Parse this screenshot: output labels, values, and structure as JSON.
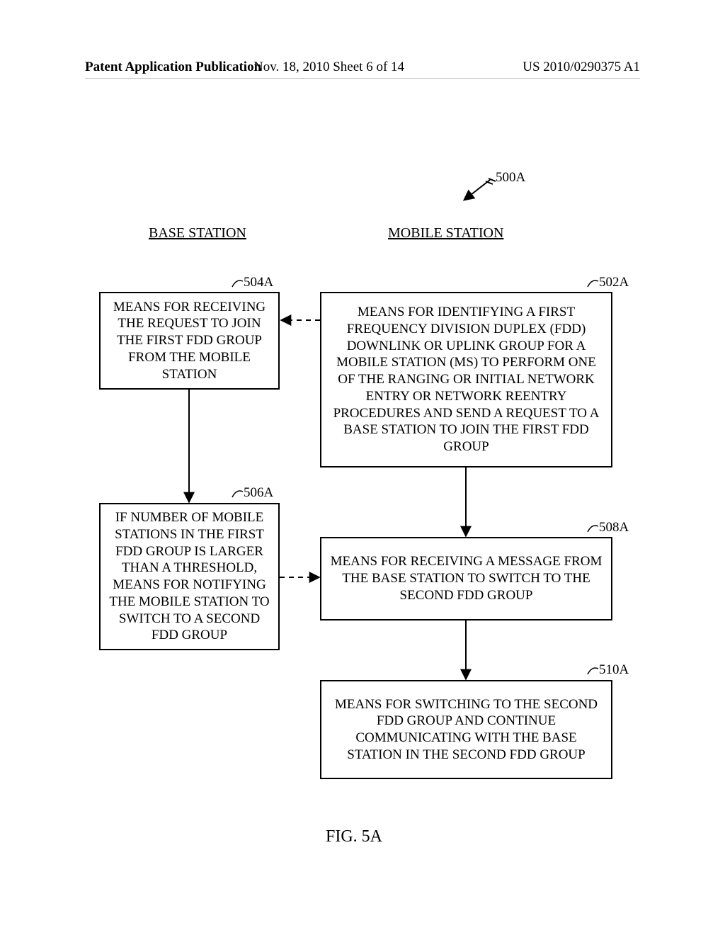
{
  "header": {
    "left": "Patent Application Publication",
    "center": "Nov. 18, 2010  Sheet 6 of 14",
    "right": "US 2010/0290375 A1"
  },
  "diagram": {
    "title_ref": "500A",
    "columns": {
      "left": "BASE STATION",
      "right": "MOBILE STATION"
    },
    "boxes": {
      "b504a": {
        "ref": "504A",
        "text": "MEANS FOR RECEIVING THE REQUEST TO JOIN THE FIRST FDD GROUP FROM THE MOBILE STATION"
      },
      "b502a": {
        "ref": "502A",
        "text": "MEANS FOR IDENTIFYING A FIRST FREQUENCY DIVISION DUPLEX (FDD) DOWNLINK OR UPLINK GROUP FOR A MOBILE STATION (MS) TO PERFORM ONE OF THE RANGING OR INITIAL NETWORK ENTRY OR NETWORK REENTRY PROCEDURES AND SEND A REQUEST TO A BASE STATION TO JOIN THE FIRST FDD GROUP"
      },
      "b506a": {
        "ref": "506A",
        "text": "IF NUMBER OF MOBILE STATIONS IN THE FIRST FDD GROUP IS LARGER THAN A THRESHOLD, MEANS FOR NOTIFYING THE MOBILE STATION TO SWITCH TO A SECOND FDD GROUP"
      },
      "b508a": {
        "ref": "508A",
        "text": "MEANS FOR RECEIVING A MESSAGE FROM THE BASE STATION TO SWITCH TO THE SECOND FDD GROUP"
      },
      "b510a": {
        "ref": "510A",
        "text": "MEANS FOR SWITCHING TO THE SECOND FDD GROUP AND CONTINUE COMMUNICATING WITH THE BASE STATION IN THE SECOND FDD GROUP"
      }
    }
  },
  "figure_caption": "FIG. 5A"
}
